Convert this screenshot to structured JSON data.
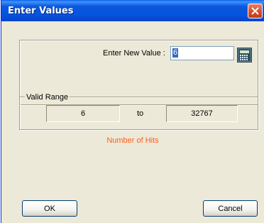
{
  "window": {
    "title": "Enter Values"
  },
  "entry": {
    "label": "Enter New Value :",
    "value": "6"
  },
  "range": {
    "legend": "Valid Range",
    "min": "6",
    "separator": "to",
    "max": "32767"
  },
  "hint": "Number of Hits",
  "buttons": {
    "ok": "OK",
    "cancel": "Cancel"
  },
  "colors": {
    "titlebar": "#0554e0",
    "hint": "#ff5c1a",
    "face": "#ece9d8"
  },
  "icons": {
    "close": "close-icon",
    "calculator": "calculator-icon"
  }
}
